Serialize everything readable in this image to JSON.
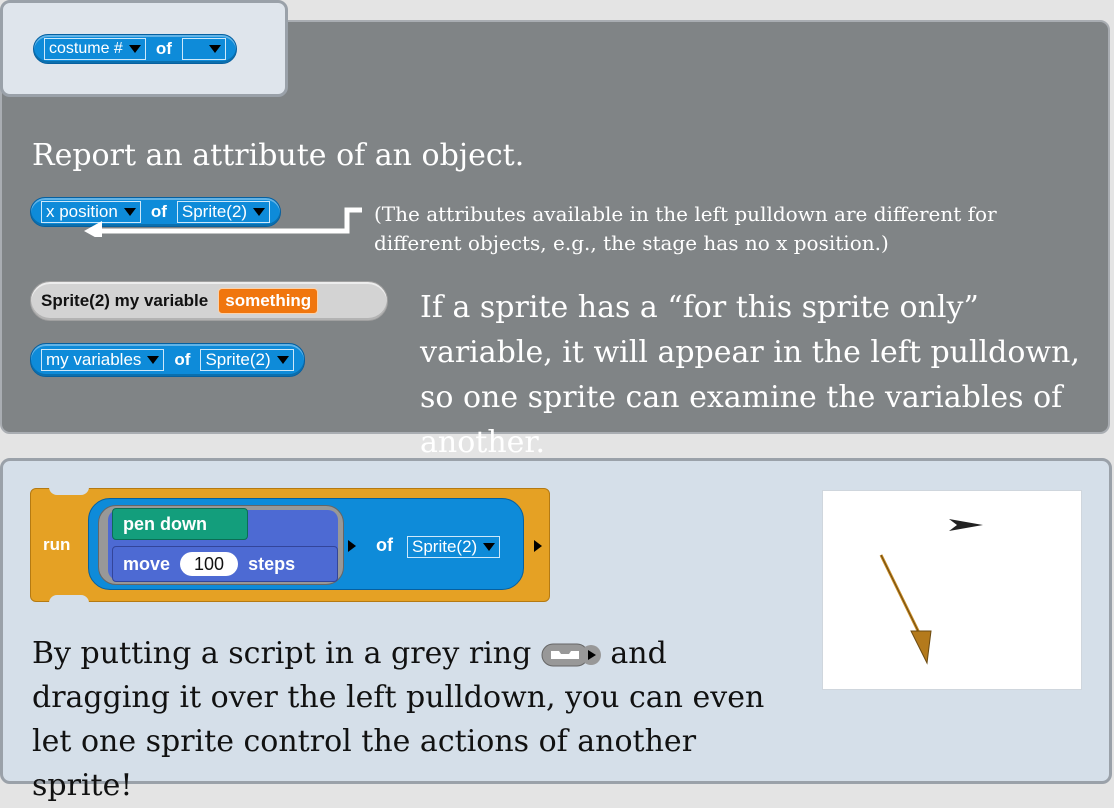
{
  "title_block": {
    "attr": "costume #",
    "of": "of",
    "object": ""
  },
  "heading": "Report an attribute of an object.",
  "example1": {
    "attr": "x position",
    "of": "of",
    "object": "Sprite(2)"
  },
  "note": "(The attributes available in the left pulldown are different for different objects, e.g., the stage has no x position.)",
  "example2": {
    "label": "Sprite(2) my variable",
    "value": "something"
  },
  "example3": {
    "attr": "my variables",
    "of": "of",
    "object": "Sprite(2)"
  },
  "explanation": "If a sprite has a “for this sprite only” variable, it will appear in the left pulldown, so one sprite can examine the variables of another.",
  "run_block": {
    "run": "run",
    "pen_down": "pen down",
    "move": "move",
    "steps_value": "100",
    "steps": "steps",
    "of": "of",
    "object": "Sprite(2)"
  },
  "bottom_text_1": "By putting a script in a grey ring",
  "bottom_text_2": "and",
  "bottom_text_3": "dragging it over the left pulldown, you can even let one sprite control the actions of another sprite!",
  "colors": {
    "motion": "#4d6ad3",
    "pen": "#139e7c",
    "control": "#e5a124",
    "sensing": "#0e8bd9",
    "variables": "#f0760e"
  }
}
